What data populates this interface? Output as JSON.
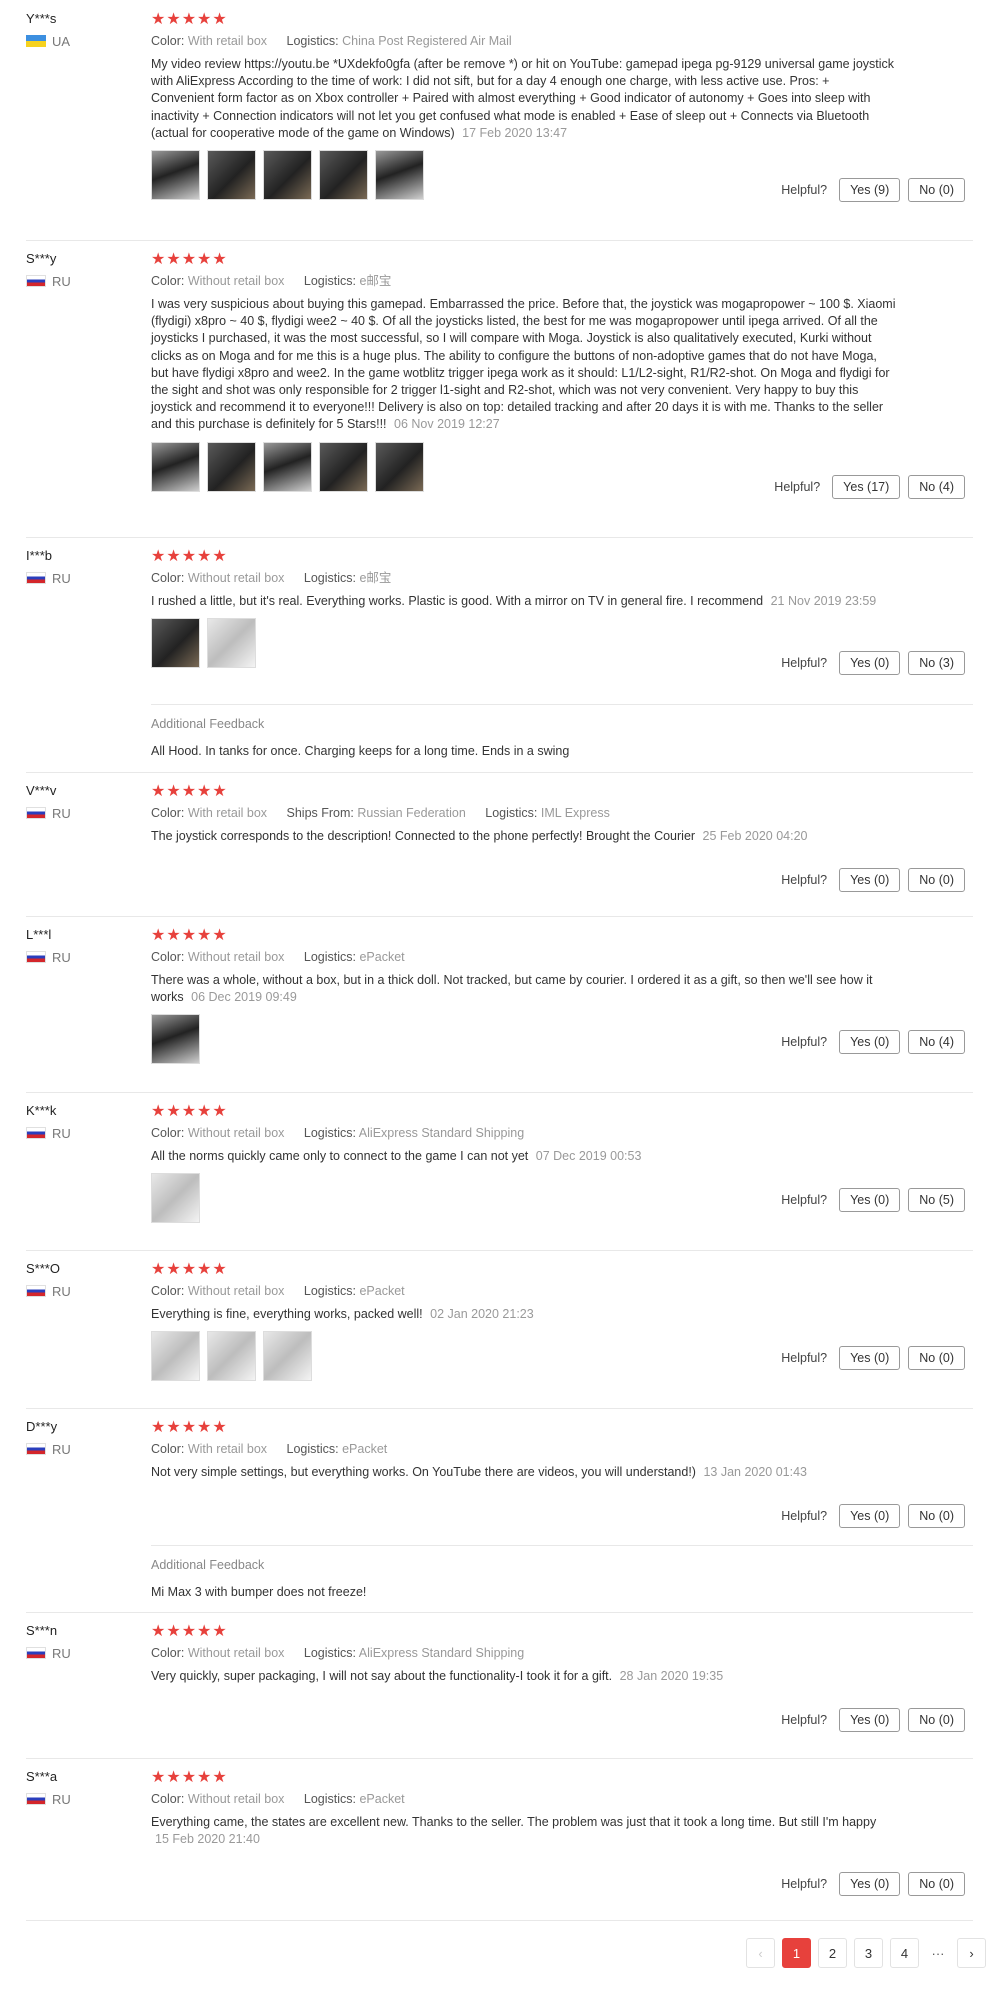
{
  "labels": {
    "color": "Color:",
    "logistics": "Logistics:",
    "ships_from": "Ships From:",
    "helpful": "Helpful?",
    "additional_feedback": "Additional Feedback"
  },
  "stars": "★★★★★",
  "rating_color": "#e7413c",
  "reviews": [
    {
      "user": "Y***s",
      "country": "UA",
      "color": "With retail box",
      "logistics": "China Post Registered Air Mail",
      "text": "My video review https://youtu.be *UXdekfo0gfa (after be remove *) or hit on YouTube: gamepad ipega pg-9129 universal game joystick with AliExpress According to the time of work: I did not sift, but for a day 4 enough one charge, with less active use. Pros: + Convenient form factor as on Xbox controller + Paired with almost everything + Good indicator of autonomy + Goes into sleep with inactivity + Connection indicators will not let you get confused what mode is enabled + Ease of sleep out + Connects via Bluetooth (actual for cooperative mode of the game on Windows)",
      "date": "17 Feb 2020 13:47",
      "yes": "Yes (9)",
      "no": "No (0)"
    },
    {
      "user": "S***y",
      "country": "RU",
      "color": "Without retail box",
      "logistics": "e邮宝",
      "text": "I was very suspicious about buying this gamepad. Embarrassed the price. Before that, the joystick was mogapropower ~ 100 $. Xiaomi (flydigi) x8pro ~ 40 $, flydigi wee2 ~ 40 $. Of all the joysticks listed, the best for me was mogapropower until ipega arrived. Of all the joysticks I purchased, it was the most successful, so I will compare with Moga. Joystick is also qualitatively executed, Kurki without clicks as on Moga and for me this is a huge plus. The ability to configure the buttons of non-adoptive games that do not have Moga, but have flydigi x8pro and wee2. In the game wotblitz trigger ipega work as it should: L1/L2-sight, R1/R2-shot. On Moga and flydigi for the sight and shot was only responsible for 2 trigger l1-sight and R2-shot, which was not very convenient. Very happy to buy this joystick and recommend it to everyone!!! Delivery is also on top: detailed tracking and after 20 days it is with me. Thanks to the seller and this purchase is definitely for 5 Stars!!!",
      "date": "06 Nov 2019 12:27",
      "yes": "Yes (17)",
      "no": "No (4)"
    },
    {
      "user": "I***b",
      "country": "RU",
      "color": "Without retail box",
      "logistics": "e邮宝",
      "text": "I rushed a little, but it's real. Everything works. Plastic is good. With a mirror on TV in general fire. I recommend",
      "date": "21 Nov 2019 23:59",
      "yes": "Yes (0)",
      "no": "No (3)",
      "additional": "All Hood. In tanks for once. Charging keeps for a long time. Ends in a swing"
    },
    {
      "user": "V***v",
      "country": "RU",
      "color": "With retail box",
      "ships_from": "Russian Federation",
      "logistics": "IML Express",
      "text": "The joystick corresponds to the description! Connected to the phone perfectly! Brought the Courier",
      "date": "25 Feb 2020 04:20",
      "yes": "Yes (0)",
      "no": "No (0)"
    },
    {
      "user": "L***l",
      "country": "RU",
      "color": "Without retail box",
      "logistics": "ePacket",
      "text": "There was a whole, without a box, but in a thick doll. Not tracked, but came by courier. I ordered it as a gift, so then we'll see how it works",
      "date": "06 Dec 2019 09:49",
      "yes": "Yes (0)",
      "no": "No (4)"
    },
    {
      "user": "K***k",
      "country": "RU",
      "color": "Without retail box",
      "logistics": "AliExpress Standard Shipping",
      "text": "All the norms quickly came only to connect to the game I can not yet",
      "date": "07 Dec 2019 00:53",
      "yes": "Yes (0)",
      "no": "No (5)"
    },
    {
      "user": "S***O",
      "country": "RU",
      "color": "Without retail box",
      "logistics": "ePacket",
      "text": "Everything is fine, everything works, packed well!",
      "date": "02 Jan 2020 21:23",
      "yes": "Yes (0)",
      "no": "No (0)"
    },
    {
      "user": "D***y",
      "country": "RU",
      "color": "With retail box",
      "logistics": "ePacket",
      "text": "Not very simple settings, but everything works. On YouTube there are videos, you will understand!)",
      "date": "13 Jan 2020 01:43",
      "yes": "Yes (0)",
      "no": "No (0)",
      "additional": "Mi Max 3 with bumper does not freeze!"
    },
    {
      "user": "S***n",
      "country": "RU",
      "color": "Without retail box",
      "logistics": "AliExpress Standard Shipping",
      "text": "Very quickly, super packaging, I will not say about the functionality-I took it for a gift.",
      "date": "28 Jan 2020 19:35",
      "yes": "Yes (0)",
      "no": "No (0)"
    },
    {
      "user": "S***a",
      "country": "RU",
      "color": "Without retail box",
      "logistics": "ePacket",
      "text": "Everything came, the states are excellent new. Thanks to the seller. The problem was just that it took a long time. But still I'm happy",
      "date": "15 Feb 2020 21:40",
      "yes": "Yes (0)",
      "no": "No (0)"
    }
  ],
  "pagination": {
    "prev": "‹",
    "pages": [
      "1",
      "2",
      "3",
      "4"
    ],
    "current": "1",
    "ellipsis": "···",
    "next": "›"
  }
}
